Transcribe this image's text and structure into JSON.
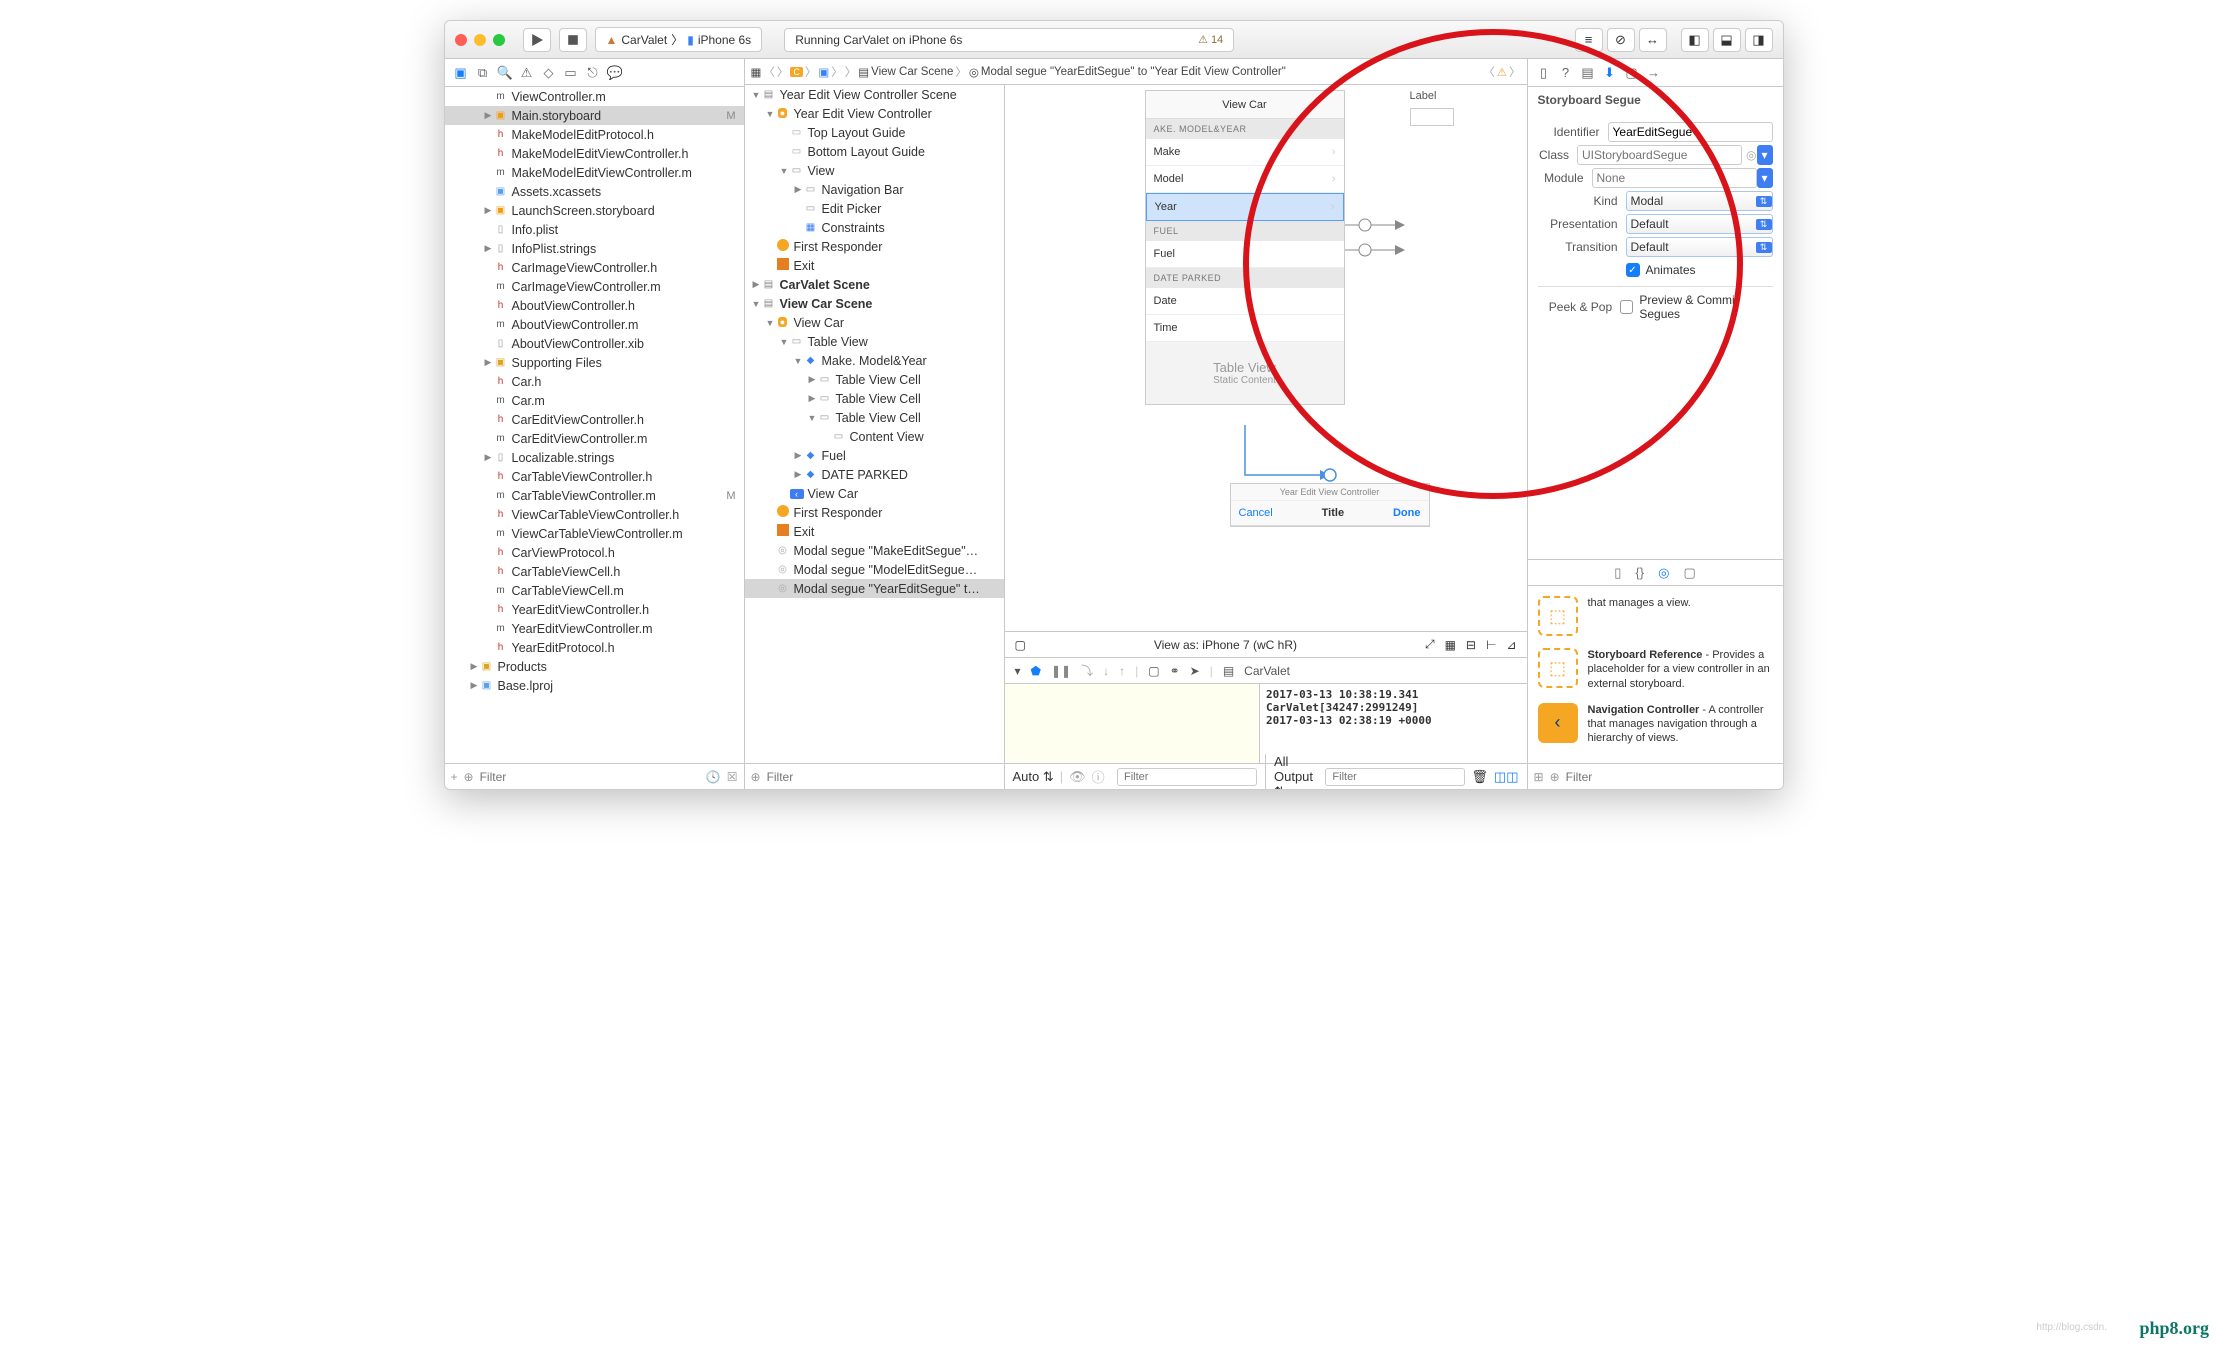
{
  "titlebar": {
    "scheme_app": "CarValet",
    "scheme_device": "iPhone 6s",
    "status": "Running CarValet on iPhone 6s",
    "warn_count": "14"
  },
  "navigator": {
    "files": [
      {
        "indent": 2,
        "kind": "m",
        "name": "ViewController.m"
      },
      {
        "indent": 2,
        "kind": "sb",
        "name": "Main.storyboard",
        "sel": true,
        "badge": "M",
        "disc": "▶"
      },
      {
        "indent": 2,
        "kind": "h",
        "name": "MakeModelEditProtocol.h"
      },
      {
        "indent": 2,
        "kind": "h",
        "name": "MakeModelEditViewController.h"
      },
      {
        "indent": 2,
        "kind": "m",
        "name": "MakeModelEditViewController.m"
      },
      {
        "indent": 2,
        "kind": "folder",
        "name": "Assets.xcassets"
      },
      {
        "indent": 2,
        "kind": "sb",
        "name": "LaunchScreen.storyboard",
        "disc": "▶"
      },
      {
        "indent": 2,
        "kind": "file",
        "name": "Info.plist"
      },
      {
        "indent": 2,
        "kind": "file",
        "name": "InfoPlist.strings",
        "disc": "▶"
      },
      {
        "indent": 2,
        "kind": "h",
        "name": "CarImageViewController.h"
      },
      {
        "indent": 2,
        "kind": "m",
        "name": "CarImageViewController.m"
      },
      {
        "indent": 2,
        "kind": "h",
        "name": "AboutViewController.h"
      },
      {
        "indent": 2,
        "kind": "m",
        "name": "AboutViewController.m"
      },
      {
        "indent": 2,
        "kind": "file",
        "name": "AboutViewController.xib"
      },
      {
        "indent": 2,
        "kind": "group",
        "name": "Supporting Files",
        "disc": "▶"
      },
      {
        "indent": 2,
        "kind": "h",
        "name": "Car.h"
      },
      {
        "indent": 2,
        "kind": "m",
        "name": "Car.m"
      },
      {
        "indent": 2,
        "kind": "h",
        "name": "CarEditViewController.h"
      },
      {
        "indent": 2,
        "kind": "m",
        "name": "CarEditViewController.m"
      },
      {
        "indent": 2,
        "kind": "file",
        "name": "Localizable.strings",
        "disc": "▶"
      },
      {
        "indent": 2,
        "kind": "h",
        "name": "CarTableViewController.h"
      },
      {
        "indent": 2,
        "kind": "m",
        "name": "CarTableViewController.m",
        "badge": "M"
      },
      {
        "indent": 2,
        "kind": "h",
        "name": "ViewCarTableViewController.h"
      },
      {
        "indent": 2,
        "kind": "m",
        "name": "ViewCarTableViewController.m"
      },
      {
        "indent": 2,
        "kind": "h",
        "name": "CarViewProtocol.h"
      },
      {
        "indent": 2,
        "kind": "h",
        "name": "CarTableViewCell.h"
      },
      {
        "indent": 2,
        "kind": "m",
        "name": "CarTableViewCell.m"
      },
      {
        "indent": 2,
        "kind": "h",
        "name": "YearEditViewController.h"
      },
      {
        "indent": 2,
        "kind": "m",
        "name": "YearEditViewController.m"
      },
      {
        "indent": 2,
        "kind": "h",
        "name": "YearEditProtocol.h"
      },
      {
        "indent": 1,
        "kind": "group",
        "name": "Products",
        "disc": "▶"
      },
      {
        "indent": 1,
        "kind": "folder",
        "name": "Base.lproj",
        "disc": "▶"
      }
    ],
    "filter_placeholder": "Filter"
  },
  "crumb": {
    "items": [
      "C",
      "View Car Scene",
      "Modal segue \"YearEditSegue\" to \"Year Edit View Controller\""
    ]
  },
  "outline": {
    "items": [
      {
        "indent": 0,
        "ico": "scene",
        "name": "Year Edit View Controller Scene",
        "disc": "▼"
      },
      {
        "indent": 1,
        "ico": "vc",
        "name": "Year Edit View Controller",
        "disc": "▼"
      },
      {
        "indent": 2,
        "ico": "guide",
        "name": "Top Layout Guide"
      },
      {
        "indent": 2,
        "ico": "guide",
        "name": "Bottom Layout Guide"
      },
      {
        "indent": 2,
        "ico": "view",
        "name": "View",
        "disc": "▼"
      },
      {
        "indent": 3,
        "ico": "view",
        "name": "Navigation Bar",
        "disc": "▶"
      },
      {
        "indent": 3,
        "ico": "view",
        "name": "Edit Picker"
      },
      {
        "indent": 3,
        "ico": "con",
        "name": "Constraints"
      },
      {
        "indent": 1,
        "ico": "first",
        "name": "First Responder"
      },
      {
        "indent": 1,
        "ico": "exit",
        "name": "Exit"
      },
      {
        "indent": 0,
        "ico": "scene",
        "name": "CarValet Scene",
        "disc": "▶",
        "bold": true
      },
      {
        "indent": 0,
        "ico": "scene",
        "name": "View Car Scene",
        "disc": "▼",
        "bold": true
      },
      {
        "indent": 1,
        "ico": "vc",
        "name": "View Car",
        "disc": "▼"
      },
      {
        "indent": 2,
        "ico": "view",
        "name": "Table View",
        "disc": "▼"
      },
      {
        "indent": 3,
        "ico": "cube",
        "name": "Make. Model&Year",
        "disc": "▼"
      },
      {
        "indent": 4,
        "ico": "view",
        "name": "Table View Cell",
        "disc": "▶"
      },
      {
        "indent": 4,
        "ico": "view",
        "name": "Table View Cell",
        "disc": "▶"
      },
      {
        "indent": 4,
        "ico": "view",
        "name": "Table View Cell",
        "disc": "▼"
      },
      {
        "indent": 5,
        "ico": "view",
        "name": "Content View"
      },
      {
        "indent": 3,
        "ico": "cube",
        "name": "Fuel",
        "disc": "▶"
      },
      {
        "indent": 3,
        "ico": "cube",
        "name": "DATE PARKED",
        "disc": "▶"
      },
      {
        "indent": 2,
        "ico": "back",
        "name": "View Car"
      },
      {
        "indent": 1,
        "ico": "first",
        "name": "First Responder"
      },
      {
        "indent": 1,
        "ico": "exit",
        "name": "Exit"
      },
      {
        "indent": 1,
        "ico": "segue",
        "name": "Modal segue \"MakeEditSegue\"…"
      },
      {
        "indent": 1,
        "ico": "segue",
        "name": "Modal segue \"ModelEditSegue…"
      },
      {
        "indent": 1,
        "ico": "segue",
        "name": "Modal segue \"YearEditSegue\" t…",
        "sel": true
      }
    ],
    "filter_placeholder": "Filter"
  },
  "canvas": {
    "nav_title": "View Car",
    "sections": {
      "s1": "AKE. MODEL&YEAR",
      "s2": "FUEL",
      "s3": "DATE PARKED"
    },
    "cells": {
      "make": "Make",
      "model": "Model",
      "year": "Year",
      "fuel": "Fuel",
      "date": "Date",
      "time": "Time"
    },
    "footer": {
      "t1": "Table View",
      "t2": "Static Content"
    },
    "label": "Label",
    "yearedit": {
      "caption": "Year Edit View Controller",
      "cancel": "Cancel",
      "title": "Title",
      "done": "Done"
    },
    "viewas": "View as: iPhone 7 (wC hR)"
  },
  "debug": {
    "target": "CarValet",
    "console_line1": "2017-03-13 10:38:19.341 CarValet[34247:2991249]",
    "console_line2": "2017-03-13 02:38:19 +0000",
    "auto": "Auto",
    "alloutput": "All Output",
    "filter": "Filter"
  },
  "inspector": {
    "title": "Storyboard Segue",
    "identifier_label": "Identifier",
    "identifier": "YearEditSegue",
    "class_label": "Class",
    "class": "UIStoryboardSegue",
    "module_label": "Module",
    "module": "None",
    "kind_label": "Kind",
    "kind": "Modal",
    "presentation_label": "Presentation",
    "presentation": "Default",
    "transition_label": "Transition",
    "transition": "Default",
    "animates": "Animates",
    "peek_label": "Peek & Pop",
    "peek": "Preview & Commit Segues"
  },
  "library": {
    "items": [
      {
        "title": "",
        "desc": "that manages a view."
      },
      {
        "title": "Storyboard Reference",
        "desc": " - Provides a placeholder for a view controller in an external storyboard."
      },
      {
        "title": "Navigation Controller",
        "desc": " - A controller that manages navigation through a hierarchy of views.",
        "nav": true
      }
    ],
    "filter_placeholder": "Filter"
  },
  "watermark": "php8.org",
  "watermark2": "http://blog.csdn."
}
